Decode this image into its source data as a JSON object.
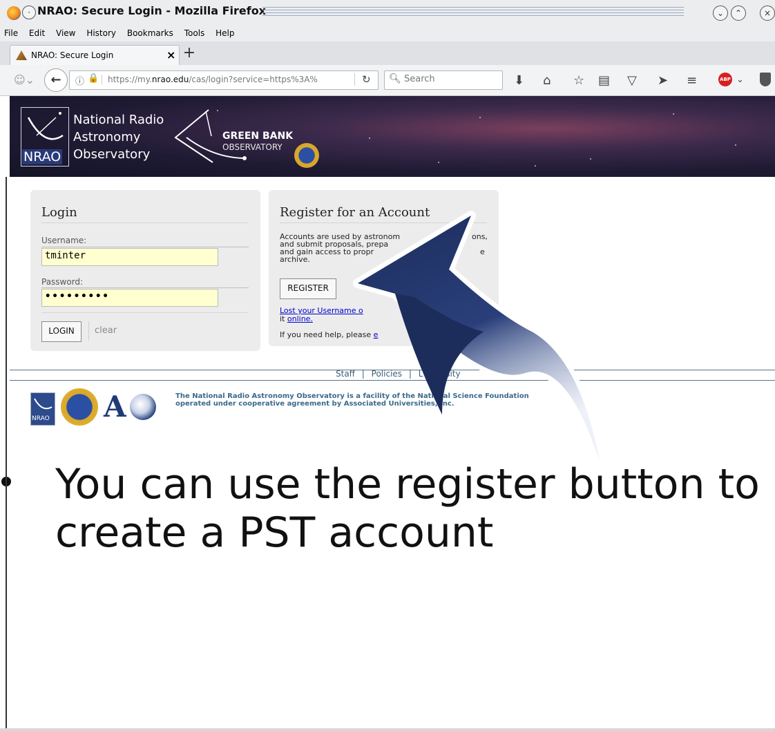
{
  "window": {
    "title": "NRAO: Secure Login - Mozilla Firefox"
  },
  "menubar": {
    "items": [
      "File",
      "Edit",
      "View",
      "History",
      "Bookmarks",
      "Tools",
      "Help"
    ]
  },
  "tabs": [
    {
      "label": "NRAO: Secure Login",
      "close": "×"
    }
  ],
  "newtab_label": "+",
  "address_bar": {
    "url_prefix": "https://my.",
    "url_domain": "nrao.edu",
    "url_rest": "/cas/login?service=https%3A%",
    "search_placeholder": "Search"
  },
  "banner": {
    "nrao_line1": "National Radio",
    "nrao_line2": "Astronomy",
    "nrao_line3": "Observatory",
    "nrao_abbr": "NRAO",
    "gbo_line1": "GREEN BANK",
    "gbo_line2": "OBSERVATORY",
    "nsf": "NSF"
  },
  "login": {
    "title": "Login",
    "username_label": "Username:",
    "username_value": "tminter",
    "password_label": "Password:",
    "password_value": "•••••••••",
    "login_button": "LOGIN",
    "clear_link": "clear"
  },
  "register": {
    "title": "Register for an Account",
    "text_line1": "Accounts are used by astronom",
    "text_line1b": "ons,",
    "text_line2": "and submit proposals, prepa",
    "text_line3": "and gain access to propr",
    "text_line3b": "e",
    "text_line4": "archive.",
    "register_button": "REGISTER",
    "lost_link": "Lost your Username o",
    "lost_it": "it ",
    "online_link": "online.",
    "help_text": "If you need help, please ",
    "help_link": "e"
  },
  "footer": {
    "links": [
      "Staff",
      "Policies",
      "L",
      "rsity"
    ],
    "separator": "|",
    "note_line1": "The National Radio Astronomy Observatory is a facility of the National Science Fo",
    "note_line1b": "undation",
    "note_line2": "operated under cooperative agreement by Associated Universities, Inc."
  },
  "slide": {
    "bullet_text": "You can use the register button to create a PST account"
  },
  "colors": {
    "arrow": "#1c2d5c",
    "field_bg": "#ffffcf",
    "link": "#0000cc"
  }
}
